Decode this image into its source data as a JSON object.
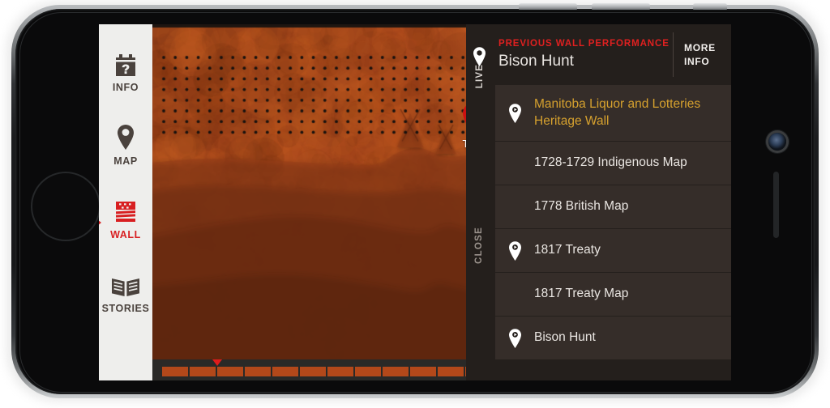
{
  "app": {
    "screen_background": "#1d1a18",
    "accent_red": "#d81f21",
    "accent_gold": "#d6a12e"
  },
  "nav": {
    "items": [
      {
        "label": "INFO",
        "icon": "castle-question-icon",
        "active": false
      },
      {
        "label": "MAP",
        "icon": "map-pin-icon",
        "active": false
      },
      {
        "label": "WALL",
        "icon": "brick-wall-icon",
        "active": true
      },
      {
        "label": "STORIES",
        "icon": "open-book-icon",
        "active": false
      }
    ]
  },
  "map": {
    "pin": {
      "label": "Tipis",
      "icon": "location-pin-icon",
      "color": "#cc1111"
    },
    "timeline": {
      "segments": 21,
      "marker_position_label": "2"
    }
  },
  "panel": {
    "rail": {
      "live_label": "LIVE",
      "live_icon": "location-pin-icon",
      "close_label": "CLOSE"
    },
    "header": {
      "kicker": "PREVIOUS WALL PERFORMANCE",
      "title": "Bison Hunt",
      "more_info_line1": "MORE",
      "more_info_line2": "INFO"
    },
    "list": [
      {
        "label": "Manitoba Liquor and Lotteries Heritage Wall",
        "icon": "play-pin-icon",
        "highlight": true,
        "tall": true
      },
      {
        "label": "1728-1729 Indigenous Map",
        "icon": "",
        "highlight": false,
        "tall": false
      },
      {
        "label": "1778 British Map",
        "icon": "",
        "highlight": false,
        "tall": false
      },
      {
        "label": "1817 Treaty",
        "icon": "play-pin-icon",
        "highlight": false,
        "tall": false
      },
      {
        "label": "1817 Treaty Map",
        "icon": "",
        "highlight": false,
        "tall": false
      },
      {
        "label": "Bison Hunt",
        "icon": "play-pin-icon",
        "highlight": false,
        "tall": false
      }
    ]
  }
}
